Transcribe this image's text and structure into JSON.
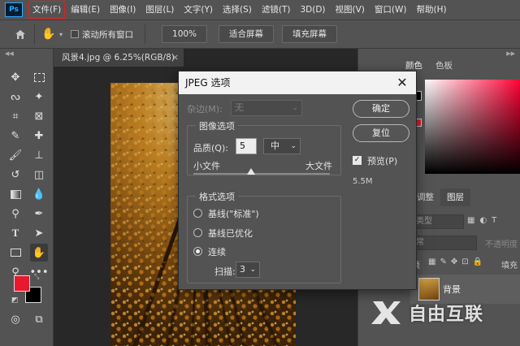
{
  "app": {
    "logo": "Ps"
  },
  "menu": [
    "文件(F)",
    "编辑(E)",
    "图像(I)",
    "图层(L)",
    "文字(Y)",
    "选择(S)",
    "滤镜(T)",
    "3D(D)",
    "视图(V)",
    "窗口(W)",
    "帮助(H)"
  ],
  "options_bar": {
    "scroll_all_label": "滚动所有窗口",
    "zoom_button": "100%",
    "fit_screen_button": "适合屏幕",
    "fill_screen_button": "填充屏幕"
  },
  "document_tab": {
    "title": "风景4.jpg @ 6.25%(RGB/8)",
    "close": "×"
  },
  "right_panel": {
    "tabs": [
      "颜色",
      "色板"
    ],
    "layers_tabs": [
      "调整",
      "图层"
    ],
    "kind_label": "类型",
    "blend_mode": "常",
    "opacity_label": "不透明度",
    "lock_label": "锁",
    "fill_label": "填充",
    "layer_name": "背景"
  },
  "dialog": {
    "title": "JPEG 选项",
    "matte_label": "杂边(M):",
    "matte_value": "无",
    "image_options_legend": "图像选项",
    "quality_label": "品质(Q):",
    "quality_value": "5",
    "quality_preset": "中",
    "small_file_label": "小文件",
    "large_file_label": "大文件",
    "quality_slider_fraction": 0.42,
    "format_options_legend": "格式选项",
    "format_options": [
      "基线(\"标准\")",
      "基线已优化",
      "连续"
    ],
    "format_selected": 2,
    "scans_label": "扫描:",
    "scans_value": "3",
    "ok_button": "确定",
    "reset_button": "复位",
    "preview_label": "预览(P)",
    "preview_checked": true,
    "file_size": "5.5M"
  },
  "watermark": {
    "text": "自由互联"
  },
  "colors": {
    "foreground": "#e8192c",
    "background": "#000000",
    "menu_highlight": "#e02020"
  }
}
